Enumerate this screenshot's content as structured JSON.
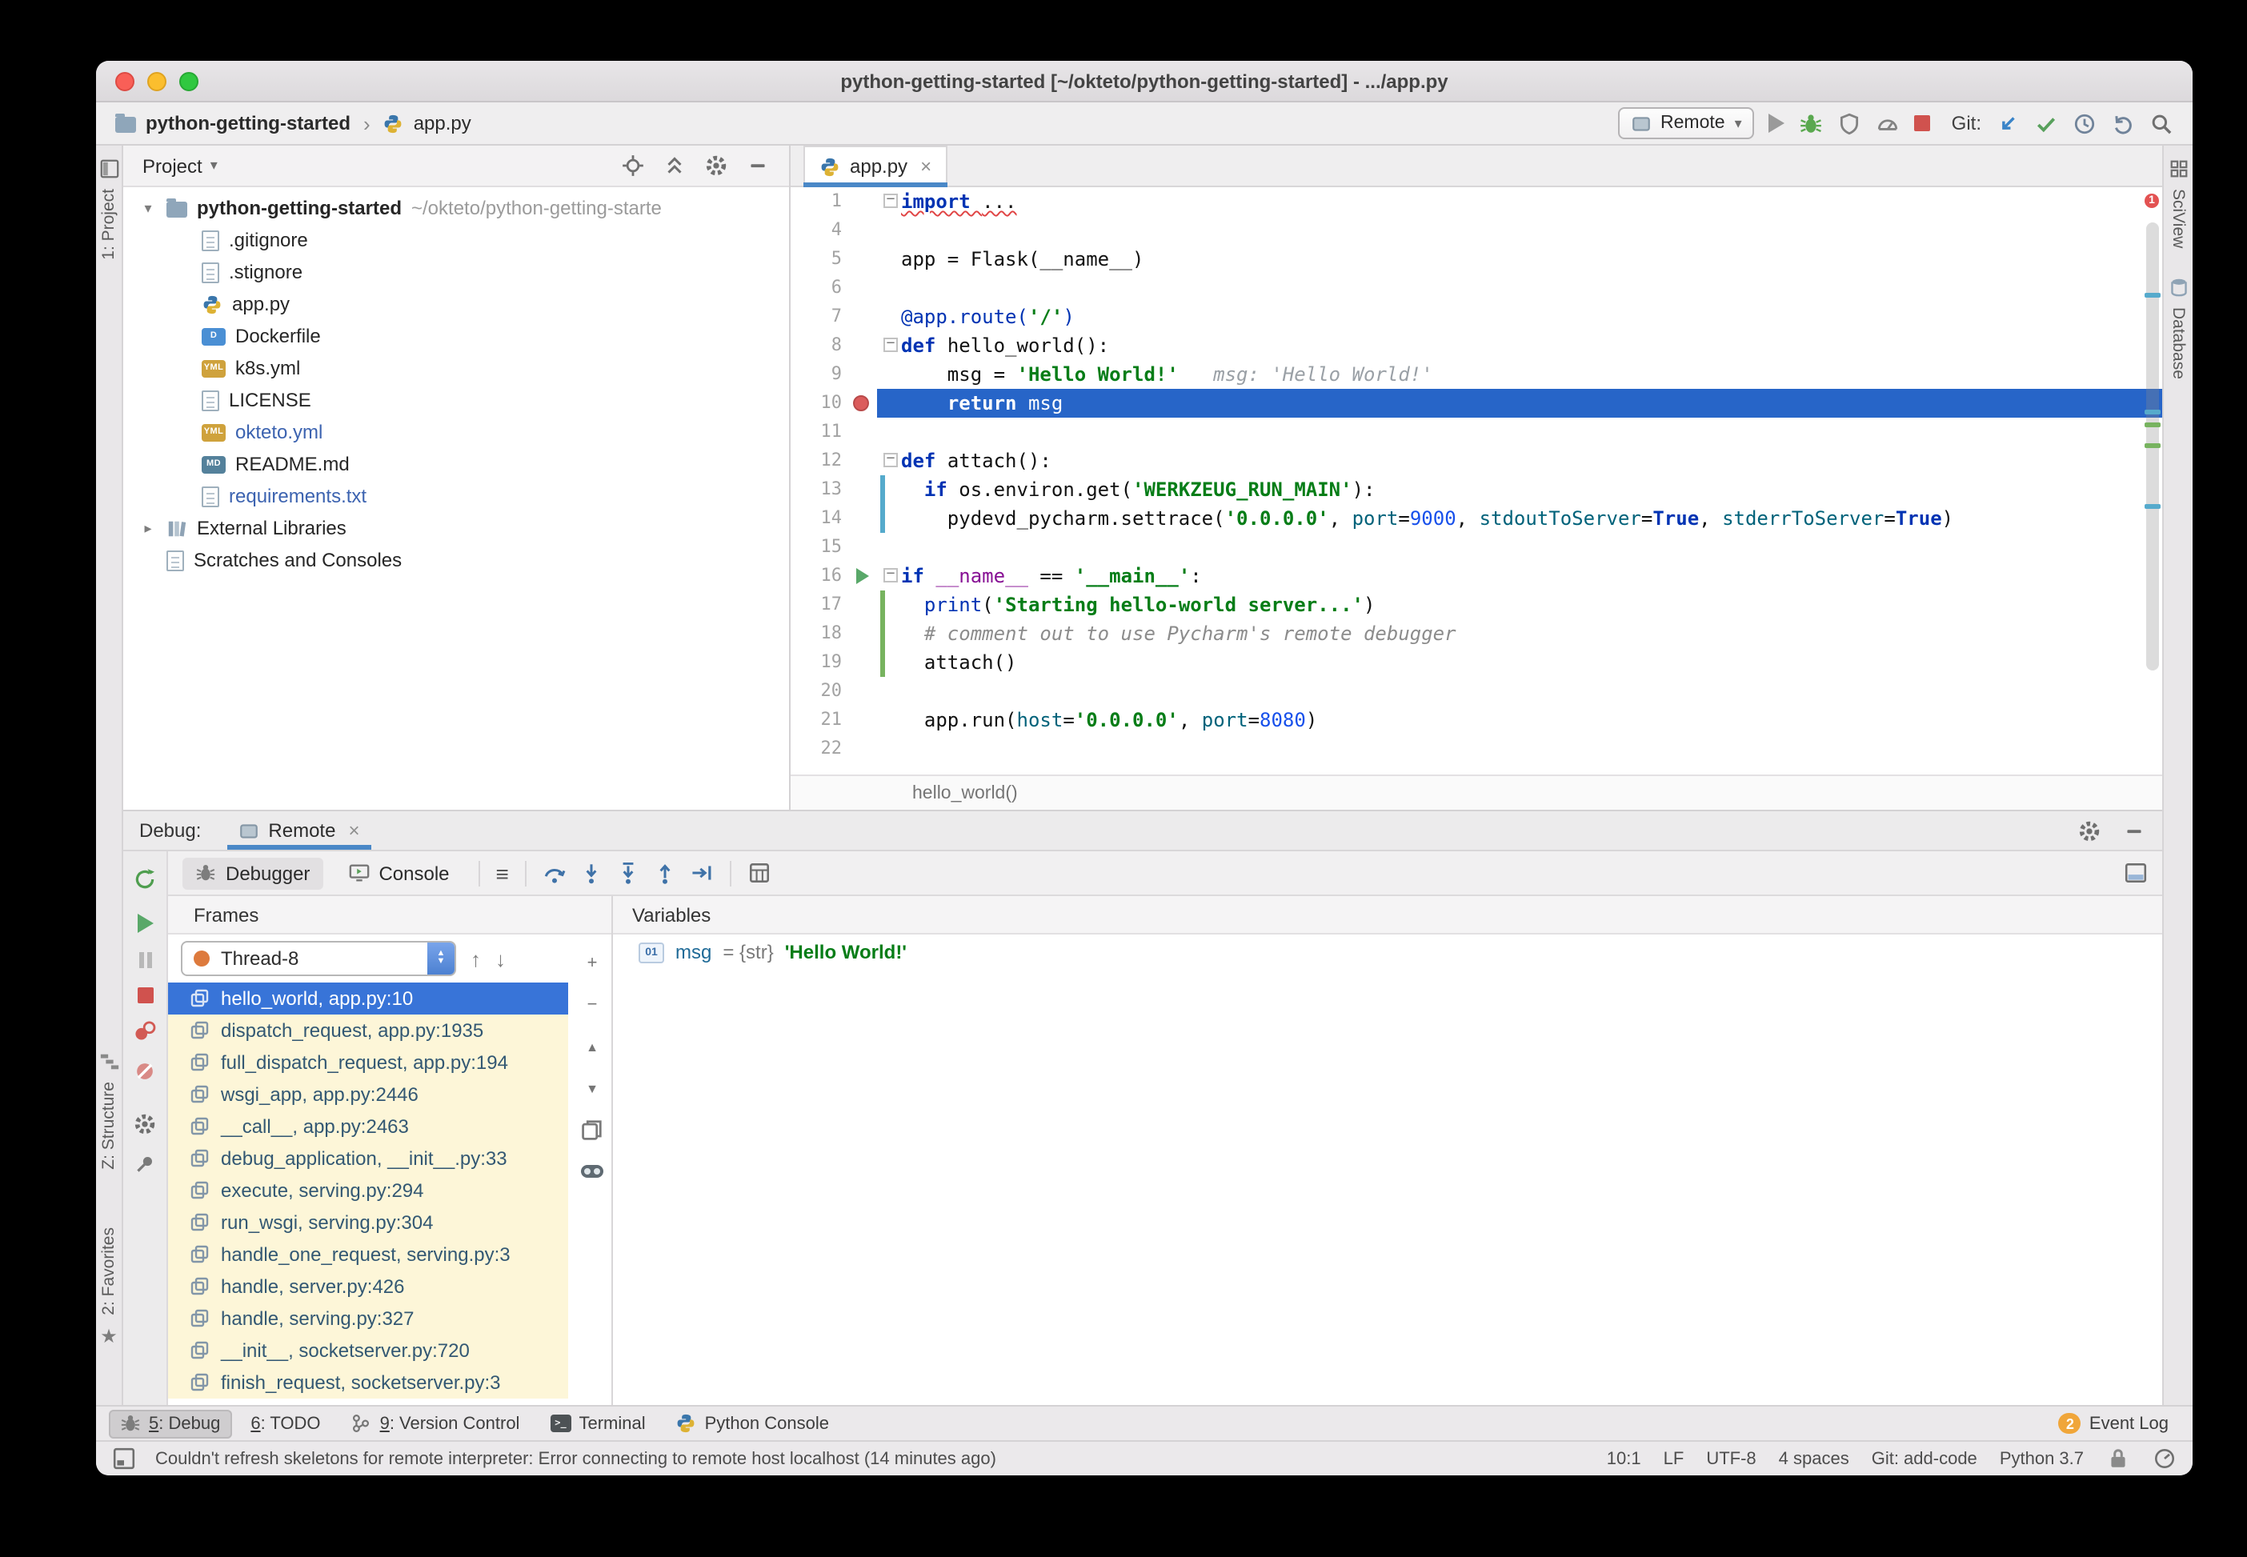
{
  "window": {
    "title": "python-getting-started [~/okteto/python-getting-started] - .../app.py"
  },
  "toolbar": {
    "project_crumb": "python-getting-started",
    "file_crumb": "app.py",
    "run_config": "Remote",
    "git_label": "Git:"
  },
  "stripes": {
    "project": "1: Project",
    "structure": "Z: Structure",
    "favorites": "2: Favorites",
    "sciview": "SciView",
    "database": "Database"
  },
  "project_panel": {
    "title": "Project",
    "root_name": "python-getting-started",
    "root_path": "~/okteto/python-getting-starte",
    "items": [
      {
        "label": ".gitignore",
        "icon": "file"
      },
      {
        "label": ".stignore",
        "icon": "file"
      },
      {
        "label": "app.py",
        "icon": "python"
      },
      {
        "label": "Dockerfile",
        "icon": "docker"
      },
      {
        "label": "k8s.yml",
        "icon": "yml"
      },
      {
        "label": "LICENSE",
        "icon": "file"
      },
      {
        "label": "okteto.yml",
        "icon": "yml",
        "modified": true
      },
      {
        "label": "README.md",
        "icon": "md"
      },
      {
        "label": "requirements.txt",
        "icon": "file",
        "modified": true
      }
    ],
    "roots2": [
      {
        "label": "External Libraries",
        "icon": "books",
        "chevron": true
      },
      {
        "label": "Scratches and Consoles",
        "icon": "file",
        "chevron": false
      }
    ]
  },
  "editor": {
    "tab": "app.py",
    "breadcrumb": "hello_world()",
    "lines": [
      {
        "n": "1",
        "fold": true,
        "segs": [
          {
            "t": "import ",
            "c": "k e"
          },
          {
            "t": "...",
            "c": "e"
          }
        ]
      },
      {
        "n": "4",
        "segs": []
      },
      {
        "n": "5",
        "segs": [
          {
            "t": "app = Flask(__name__)"
          }
        ]
      },
      {
        "n": "6",
        "segs": []
      },
      {
        "n": "7",
        "segs": [
          {
            "t": "@app.route(",
            "c": "d"
          },
          {
            "t": "'/'",
            "c": "s"
          },
          {
            "t": ")",
            "c": "d"
          }
        ]
      },
      {
        "n": "8",
        "fold": true,
        "segs": [
          {
            "t": "def ",
            "c": "k"
          },
          {
            "t": "hello_world():"
          }
        ]
      },
      {
        "n": "9",
        "segs": [
          {
            "t": "    msg = "
          },
          {
            "t": "'Hello World!'",
            "c": "s"
          },
          {
            "t": "   msg: 'Hello World!'",
            "c": "h"
          }
        ]
      },
      {
        "n": "10",
        "bp": true,
        "exec": true,
        "segs": [
          {
            "t": "    "
          },
          {
            "t": "return ",
            "c": "k"
          },
          {
            "t": "msg"
          }
        ]
      },
      {
        "n": "11",
        "segs": []
      },
      {
        "n": "12",
        "fold": true,
        "segs": [
          {
            "t": "def ",
            "c": "k"
          },
          {
            "t": "attach():"
          }
        ]
      },
      {
        "n": "13",
        "vcs": "mod",
        "segs": [
          {
            "t": "  "
          },
          {
            "t": "if ",
            "c": "k"
          },
          {
            "t": "os.environ.get("
          },
          {
            "t": "'WERKZEUG_RUN_MAIN'",
            "c": "s"
          },
          {
            "t": "):"
          }
        ]
      },
      {
        "n": "14",
        "vcs": "mod",
        "segs": [
          {
            "t": "    pydevd_pycharm.settrace("
          },
          {
            "t": "'0.0.0.0'",
            "c": "s"
          },
          {
            "t": ", "
          },
          {
            "t": "port",
            "c": "p"
          },
          {
            "t": "="
          },
          {
            "t": "9000",
            "c": "num"
          },
          {
            "t": ", "
          },
          {
            "t": "stdoutToServer",
            "c": "p"
          },
          {
            "t": "="
          },
          {
            "t": "True",
            "c": "k"
          },
          {
            "t": ", "
          },
          {
            "t": "stderrToServer",
            "c": "p"
          },
          {
            "t": "="
          },
          {
            "t": "True",
            "c": "k"
          },
          {
            "t": ")"
          }
        ]
      },
      {
        "n": "15",
        "segs": []
      },
      {
        "n": "16",
        "fold": true,
        "run": true,
        "segs": [
          {
            "t": "if ",
            "c": "k"
          },
          {
            "t": "__name__",
            "c": "m"
          },
          {
            "t": " == "
          },
          {
            "t": "'__main__'",
            "c": "s"
          },
          {
            "t": ":"
          }
        ]
      },
      {
        "n": "17",
        "vcs": "add",
        "segs": [
          {
            "t": "  "
          },
          {
            "t": "print",
            "c": "b"
          },
          {
            "t": "("
          },
          {
            "t": "'Starting hello-world server...'",
            "c": "s"
          },
          {
            "t": ")"
          }
        ]
      },
      {
        "n": "18",
        "vcs": "add",
        "segs": [
          {
            "t": "  "
          },
          {
            "t": "# comment out to use Pycharm's remote debugger",
            "c": "cm"
          }
        ]
      },
      {
        "n": "19",
        "vcs": "add",
        "segs": [
          {
            "t": "  attach()"
          }
        ]
      },
      {
        "n": "20",
        "segs": []
      },
      {
        "n": "21",
        "segs": [
          {
            "t": "  app.run("
          },
          {
            "t": "host",
            "c": "p"
          },
          {
            "t": "="
          },
          {
            "t": "'0.0.0.0'",
            "c": "s"
          },
          {
            "t": ", "
          },
          {
            "t": "port",
            "c": "p"
          },
          {
            "t": "="
          },
          {
            "t": "8080",
            "c": "num"
          },
          {
            "t": ")"
          }
        ]
      },
      {
        "n": "22",
        "segs": []
      }
    ]
  },
  "debug": {
    "panel_label": "Debug:",
    "tab": "Remote",
    "tabs": {
      "debugger": "Debugger",
      "console": "Console"
    },
    "frames_header": "Frames",
    "variables_header": "Variables",
    "thread": "Thread-8",
    "frames": [
      {
        "label": "hello_world, app.py:10",
        "selected": true
      },
      {
        "label": "dispatch_request, app.py:1935"
      },
      {
        "label": "full_dispatch_request, app.py:194"
      },
      {
        "label": "wsgi_app, app.py:2446"
      },
      {
        "label": "__call__, app.py:2463"
      },
      {
        "label": "debug_application, __init__.py:33"
      },
      {
        "label": "execute, serving.py:294"
      },
      {
        "label": "run_wsgi, serving.py:304"
      },
      {
        "label": "handle_one_request, serving.py:3"
      },
      {
        "label": "handle, server.py:426"
      },
      {
        "label": "handle, serving.py:327"
      },
      {
        "label": "__init__, socketserver.py:720"
      },
      {
        "label": "finish_request, socketserver.py:3"
      }
    ],
    "variables": [
      {
        "badge": "01",
        "name": "msg",
        "eq": " = ",
        "type": "{str}",
        "value": "'Hello World!'"
      }
    ]
  },
  "toolwindow_bar": {
    "left": [
      {
        "mnemonic": "5",
        "label": ": Debug",
        "icon": "debug",
        "active": true
      },
      {
        "mnemonic": "6",
        "label": ": TODO"
      },
      {
        "mnemonic": "9",
        "label": ": Version Control",
        "icon": "vcs"
      },
      {
        "label": "Terminal",
        "icon": "terminal"
      },
      {
        "label": "Python Console",
        "icon": "python"
      }
    ],
    "right": [
      {
        "label": "Event Log",
        "badge": "2"
      }
    ]
  },
  "status_bar": {
    "message": "Couldn't refresh skeletons for remote interpreter: Error connecting to remote host localhost (14 minutes ago)",
    "items": [
      "10:1",
      "LF",
      "UTF-8",
      "4 spaces",
      "Git: add-code",
      "Python 3.7"
    ]
  },
  "icons": {
    "dropdown": "▾",
    "chevron_sep": "›",
    "tree_expanded": "▾",
    "tree_collapsed": "▸",
    "close": "×",
    "hamburger": "≡",
    "up": "↑",
    "down": "↓",
    "plus": "+",
    "minus": "−",
    "stepper_up": "▲",
    "stepper_down": "▼",
    "star": "★",
    "error_count": "1",
    "terminal_glyph": ">_"
  }
}
